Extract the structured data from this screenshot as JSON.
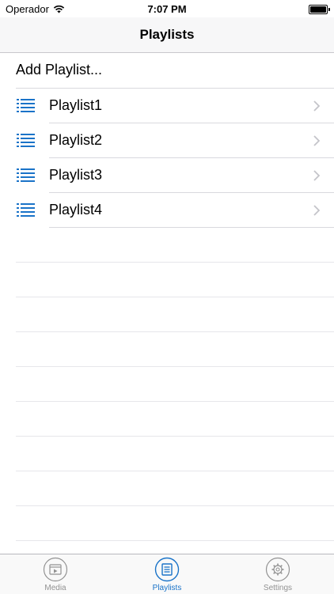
{
  "status_bar": {
    "carrier": "Operador",
    "time": "7:07 PM"
  },
  "nav": {
    "title": "Playlists"
  },
  "add_playlist_label": "Add Playlist...",
  "playlists": [
    {
      "label": "Playlist1"
    },
    {
      "label": "Playlist2"
    },
    {
      "label": "Playlist3"
    },
    {
      "label": "Playlist4"
    }
  ],
  "tabs": [
    {
      "label": "Media",
      "icon": "media-icon",
      "active": false
    },
    {
      "label": "Playlists",
      "icon": "playlists-icon",
      "active": true
    },
    {
      "label": "Settings",
      "icon": "settings-icon",
      "active": false
    }
  ],
  "colors": {
    "accent": "#1a73c8",
    "inactive": "#929292",
    "separator": "#d9d9de"
  }
}
